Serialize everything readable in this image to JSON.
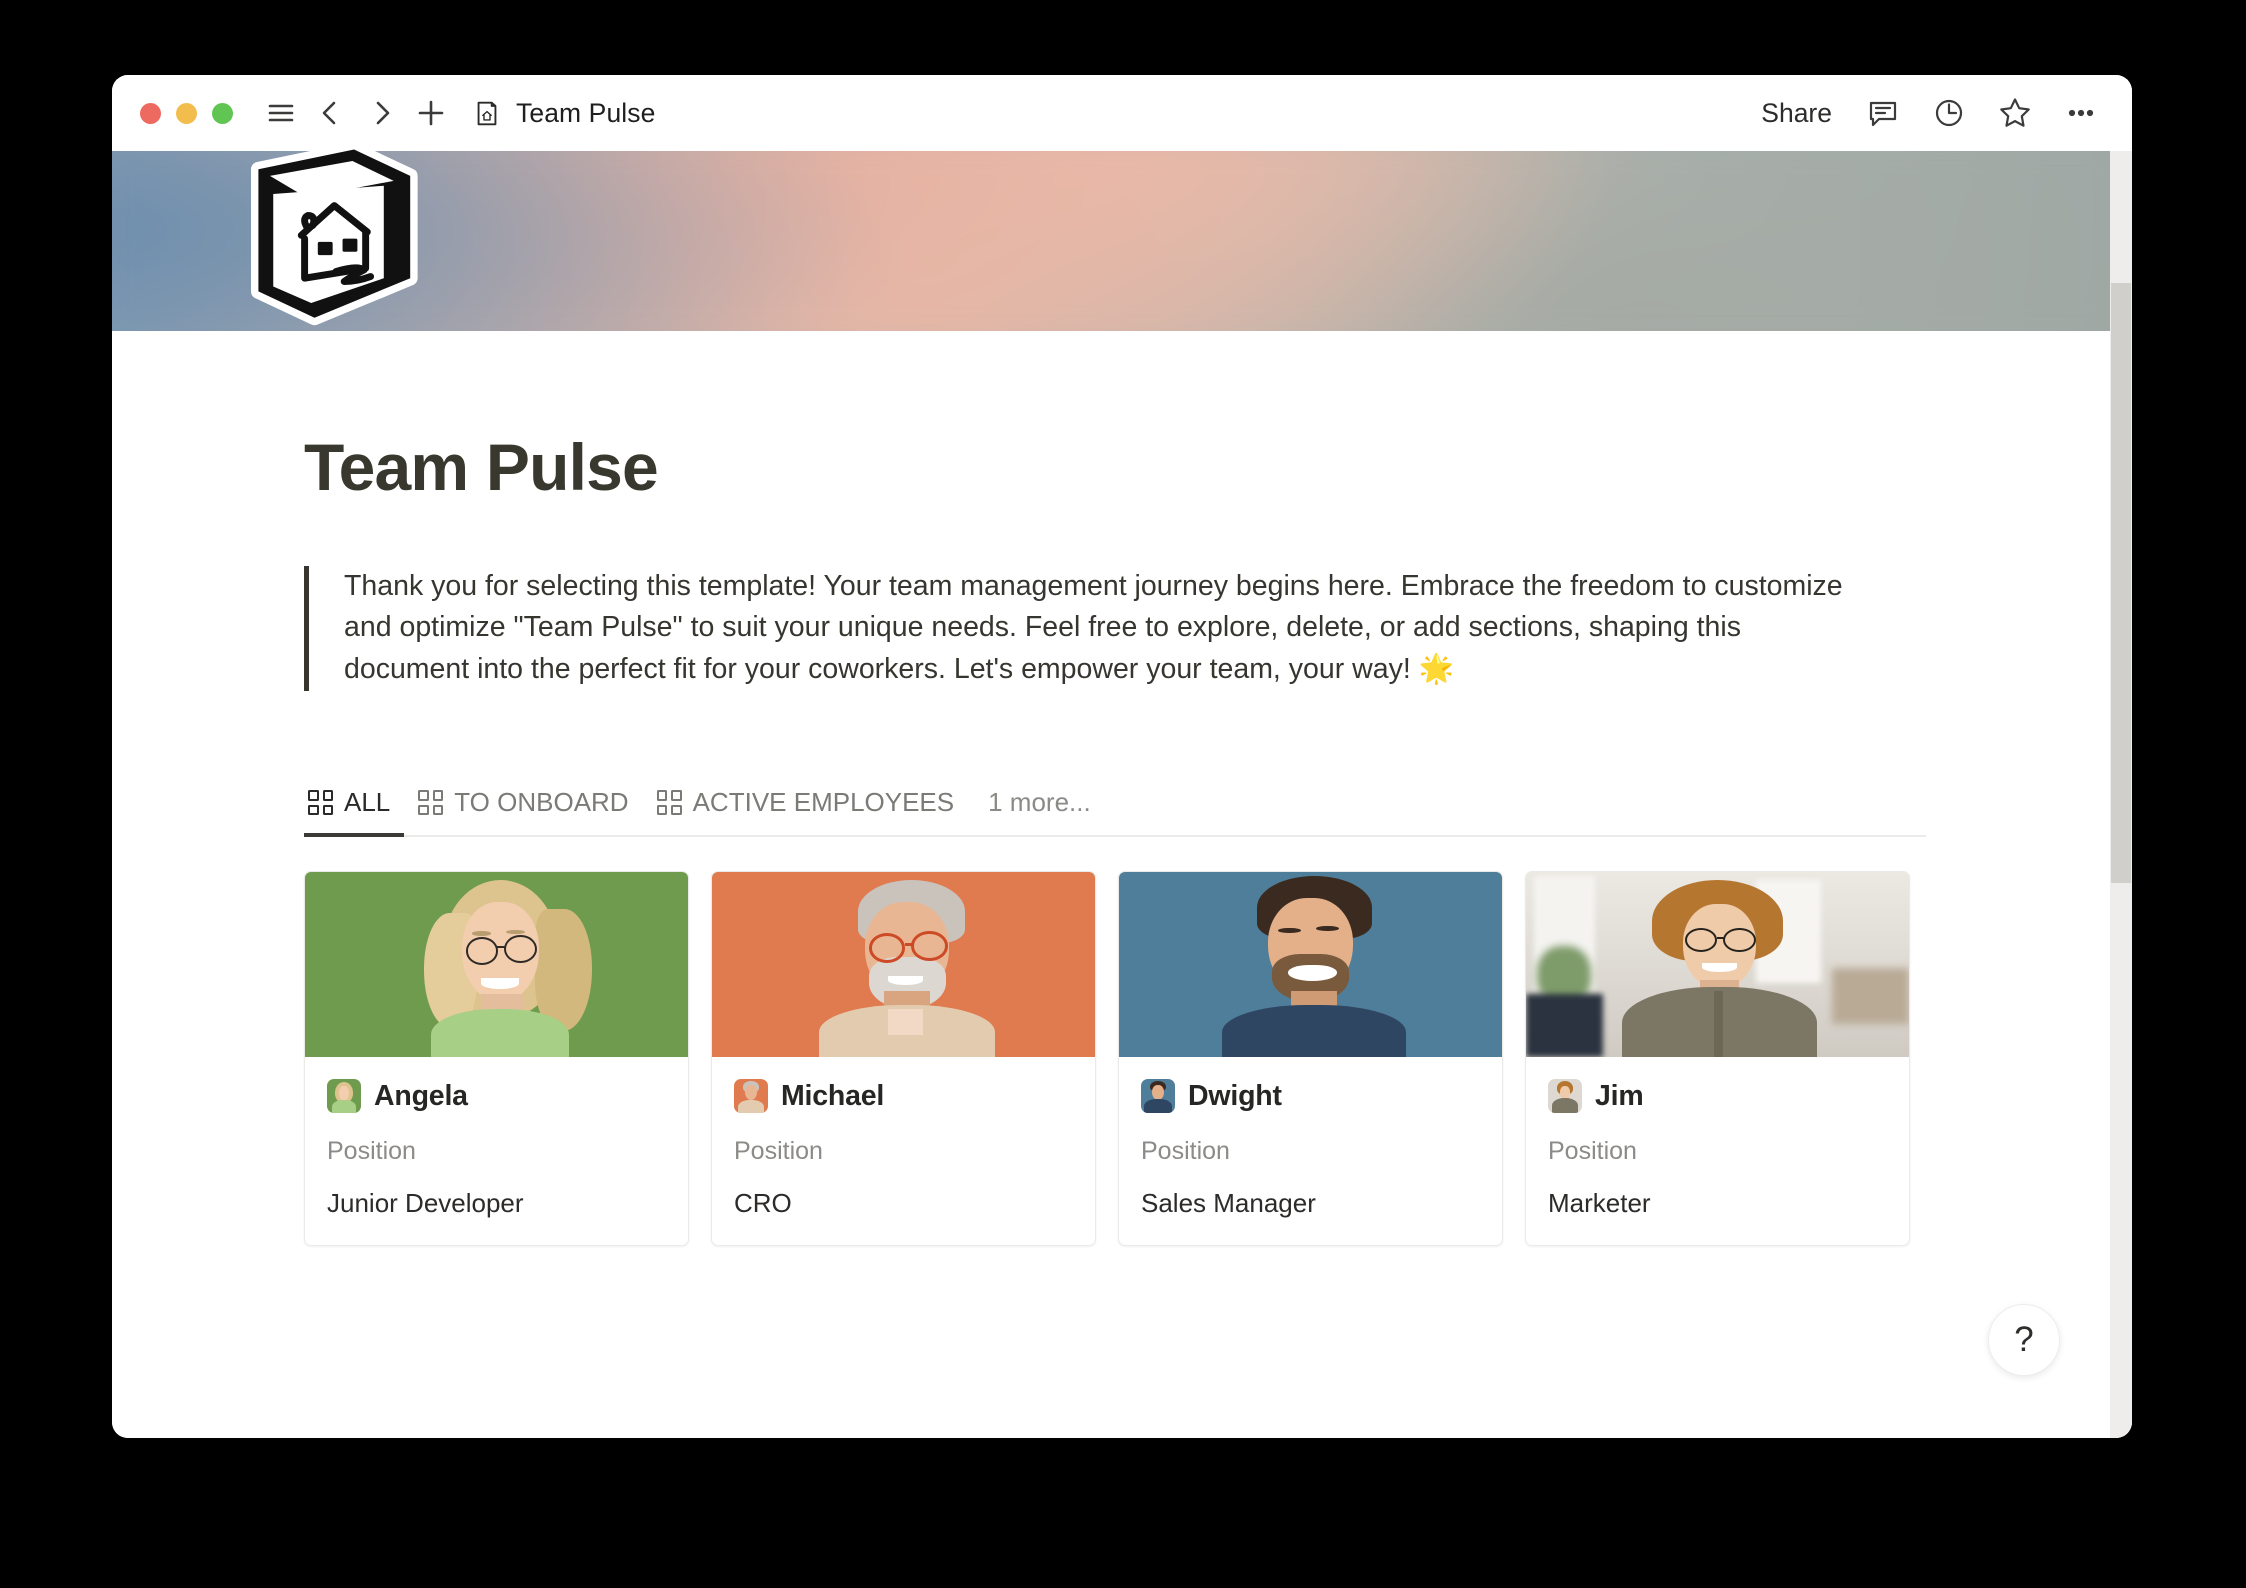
{
  "window": {
    "traffic_lights": [
      "close",
      "minimize",
      "maximize"
    ],
    "doc_title": "Team Pulse",
    "share_label": "Share"
  },
  "page": {
    "title": "Team Pulse",
    "quote": "Thank you for selecting this template! Your team management journey begins here. Embrace the freedom to customize and optimize \"Team Pulse\" to suit your unique needs. Feel free to explore, delete, or add sections, shaping this document into the perfect fit for your coworkers. Let's empower your team, your way! 🌟",
    "icon_name": "cube-house-icon",
    "banner_colors": [
      "#7f9cb6",
      "#e9bca9",
      "#a9b2ae"
    ]
  },
  "view_tabs": {
    "items": [
      {
        "label": "ALL",
        "icon": "gallery-grid-icon",
        "active": true
      },
      {
        "label": "TO ONBOARD",
        "icon": "gallery-grid-icon",
        "active": false
      },
      {
        "label": "ACTIVE EMPLOYEES",
        "icon": "gallery-grid-icon",
        "active": false
      }
    ],
    "more_label": "1 more..."
  },
  "gallery": {
    "property_label": "Position",
    "cards": [
      {
        "name": "Angela",
        "position": "Junior Developer",
        "bg": "#6f9b4e"
      },
      {
        "name": "Michael",
        "position": "CRO",
        "bg": "#e07a4f"
      },
      {
        "name": "Dwight",
        "position": "Sales Manager",
        "bg": "#4f7e9b"
      },
      {
        "name": "Jim",
        "position": "Marketer",
        "bg": "#dfdcd6"
      }
    ]
  },
  "help": {
    "label": "?"
  },
  "icons": {
    "menu": "hamburger-menu-icon",
    "back": "chevron-left-icon",
    "forward": "chevron-right-icon",
    "new": "plus-icon",
    "doc": "page-icon",
    "comments": "comment-icon",
    "history": "clock-icon",
    "favorite": "star-icon",
    "more": "ellipsis-icon"
  }
}
